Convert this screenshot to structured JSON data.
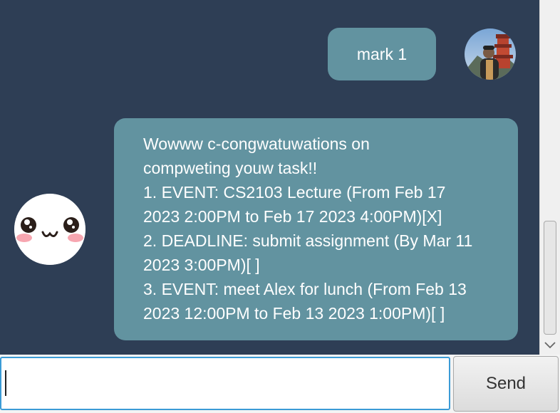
{
  "conversation": {
    "user_message": "mark 1",
    "bot_response_lines": [
      "Wowww c-congwatuwations on",
      "compweting youw task!!",
      "1. EVENT: CS2103 Lecture (From Feb 17",
      "2023 2:00PM to Feb 17 2023 4:00PM)[X]",
      "2. DEADLINE: submit assignment (By Mar 11",
      "2023 3:00PM)[ ]",
      "3. EVENT: meet Alex for lunch (From Feb 13",
      "2023 12:00PM to Feb 13 2023 1:00PM)[ ]"
    ]
  },
  "input": {
    "value": "",
    "send_label": "Send"
  },
  "icons": {
    "user_avatar": "user-photo-avatar",
    "bot_avatar": "cute-face-avatar",
    "scroll_down": "chevron-down-icon"
  },
  "colors": {
    "background": "#2e3e55",
    "bubble": "#6293a0",
    "input_focus": "#3b9bd6"
  }
}
